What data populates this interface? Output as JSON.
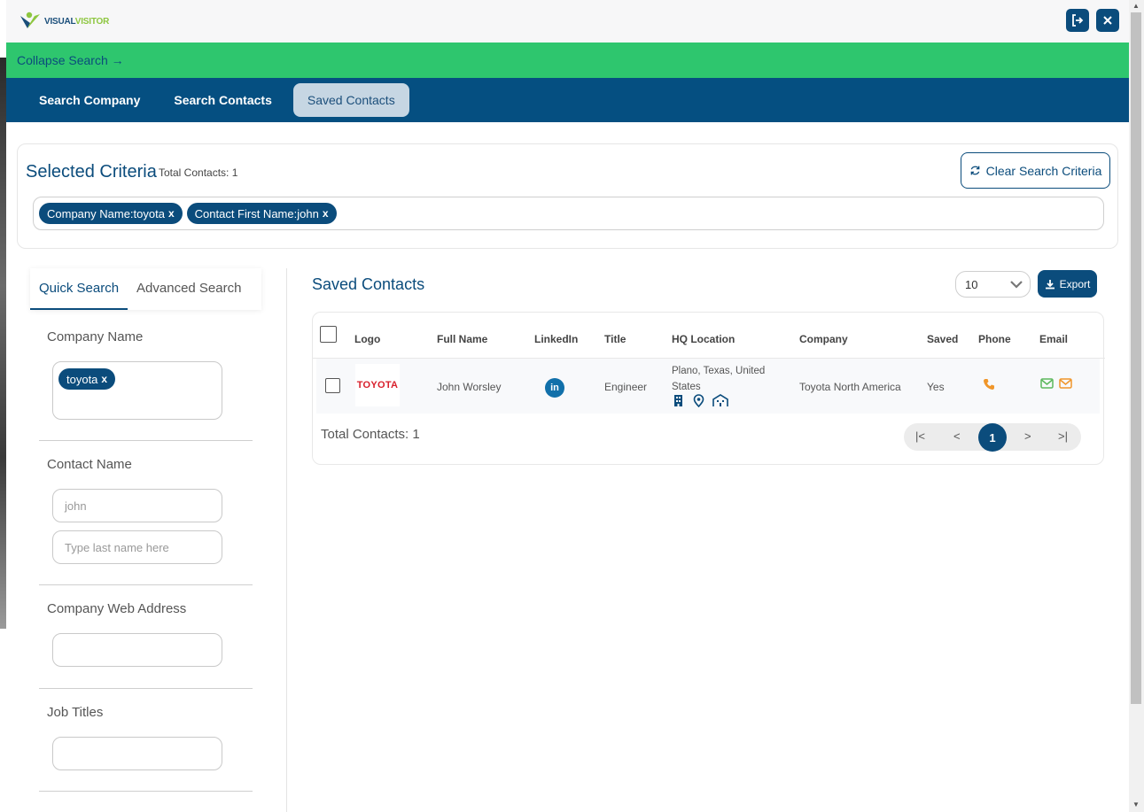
{
  "brand": {
    "logo_part1": "VISUAL",
    "logo_part2": "VISITOR"
  },
  "colors": {
    "primary": "#0b4c7c",
    "nav": "#054f81",
    "green": "#2ec66e",
    "active_tab": "#c6d6e3"
  },
  "top_actions": [
    "logout-icon",
    "close-icon"
  ],
  "greenbar": {
    "collapse_label": "Collapse Search →"
  },
  "nav": {
    "tabs": [
      "Search Company",
      "Search Contacts",
      "Saved Contacts"
    ],
    "active": "Saved Contacts"
  },
  "criteria": {
    "title": "Selected Criteria",
    "total_label": "Total Contacts: 1",
    "clear_label": "Clear Search Criteria",
    "chips": [
      "Company Name:toyota",
      "Contact First Name:john"
    ],
    "chip_remove": "x"
  },
  "sidebar": {
    "tabs": [
      "Quick Search",
      "Advanced Search"
    ],
    "active_tab": "Quick Search",
    "company_name": {
      "label": "Company Name",
      "chip": "toyota",
      "chip_remove": "x"
    },
    "contact_name": {
      "label": "Contact Name",
      "first_value": "john",
      "last_placeholder": "Type last name here"
    },
    "web_address": {
      "label": "Company Web Address",
      "value": ""
    },
    "job_titles": {
      "label": "Job Titles",
      "value": ""
    }
  },
  "main": {
    "title": "Saved Contacts",
    "per_page": "10",
    "export_label": "Export",
    "columns": [
      "Logo",
      "Full Name",
      "LinkedIn",
      "Title",
      "HQ Location",
      "Company",
      "Saved",
      "Phone",
      "Email"
    ],
    "rows": [
      {
        "logo_text": "TOYOTA",
        "full_name": "John Worsley",
        "linkedin": "in",
        "title": "Engineer",
        "hq_location": "Plano, Texas, United States",
        "company": "Toyota North America",
        "saved": "Yes"
      }
    ],
    "total_label": "Total Contacts: 1",
    "pagination": {
      "first": "|<",
      "prev": "<",
      "current": "1",
      "next": ">",
      "last": ">|"
    }
  }
}
